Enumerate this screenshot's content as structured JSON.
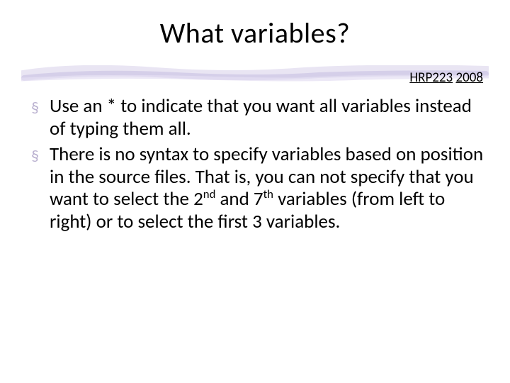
{
  "title": "What variables?",
  "course": {
    "code": "HRP223",
    "year": "2008"
  },
  "bullets": [
    {
      "text": "Use an * to indicate that you want all variables instead of typing them all."
    },
    {
      "html": "There is no syntax to specify variables based on position in the source files.  That is, you can not specify that you want to select the 2<sup>nd</sup> and 7<sup>th</sup> variables (from left to right) or to select the first 3 variables."
    }
  ],
  "marker": "§"
}
